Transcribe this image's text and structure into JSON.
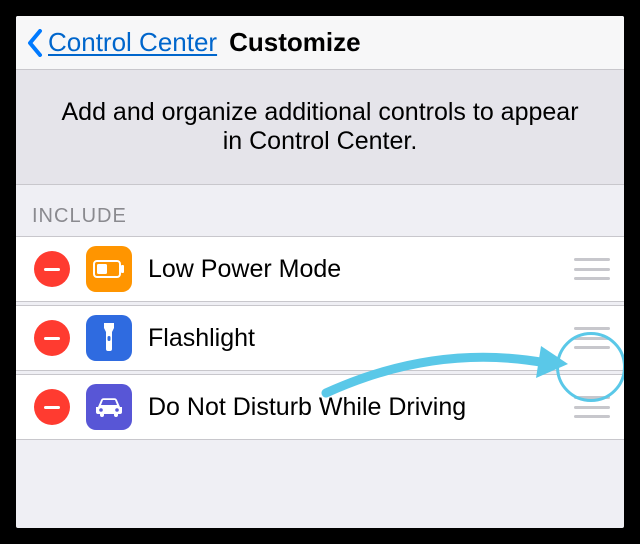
{
  "navbar": {
    "back_label": "Control Center",
    "title": "Customize"
  },
  "intro_text": "Add and organize additional controls to appear in Control Center.",
  "section_header": "INCLUDE",
  "rows": [
    {
      "label": "Low Power Mode",
      "icon_bg": "#ff9500",
      "icon": "battery"
    },
    {
      "label": "Flashlight",
      "icon_bg": "#2f6be0",
      "icon": "flashlight"
    },
    {
      "label": "Do Not Disturb While Driving",
      "icon_bg": "#5856d6",
      "icon": "car"
    }
  ],
  "colors": {
    "remove": "#ff3b30",
    "annotation": "#5ac8e8"
  }
}
